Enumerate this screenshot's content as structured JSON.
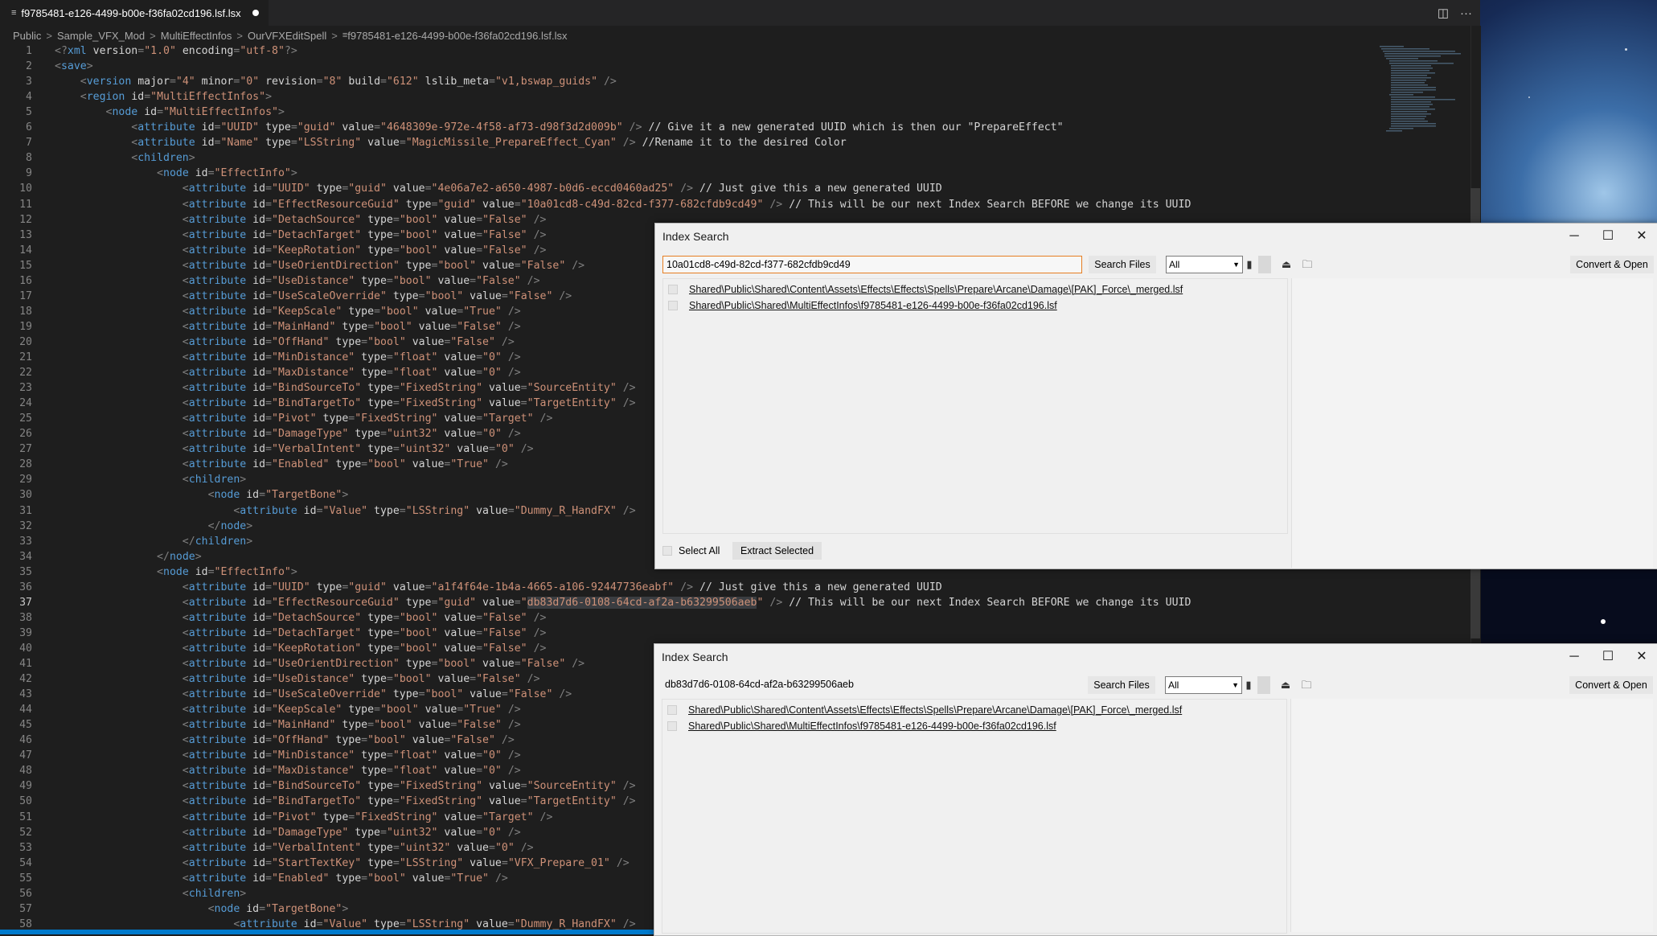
{
  "editor": {
    "tab": {
      "filename": "f9785481-e126-4499-b00e-f36fa02cd196.lsf.lsx",
      "modified_dot": "●"
    },
    "breadcrumb": [
      "Public",
      "Sample_VFX_Mod",
      "MultiEffectInfos",
      "OurVFXEditSpell",
      "f9785481-e126-4499-b00e-f36fa02cd196.lsf.lsx"
    ],
    "breadcrumb_sep": ">",
    "active_line": 37,
    "lines": [
      "<?xml version=\"1.0\" encoding=\"utf-8\"?>",
      "<save>",
      "    <version major=\"4\" minor=\"0\" revision=\"8\" build=\"612\" lslib_meta=\"v1,bswap_guids\" />",
      "    <region id=\"MultiEffectInfos\">",
      "        <node id=\"MultiEffectInfos\">",
      "            <attribute id=\"UUID\" type=\"guid\" value=\"4648309e-972e-4f58-af73-d98f3d2d009b\" /> // Give it a new generated UUID which is then our \"PrepareEffect\"",
      "            <attribute id=\"Name\" type=\"LSString\" value=\"MagicMissile_PrepareEffect_Cyan\" /> //Rename it to the desired Color",
      "            <children>",
      "                <node id=\"EffectInfo\">",
      "                    <attribute id=\"UUID\" type=\"guid\" value=\"4e06a7e2-a650-4987-b0d6-eccd0460ad25\" /> // Just give this a new generated UUID",
      "                    <attribute id=\"EffectResourceGuid\" type=\"guid\" value=\"10a01cd8-c49d-82cd-f377-682cfdb9cd49\" /> // This will be our next Index Search BEFORE we change its UUID",
      "                    <attribute id=\"DetachSource\" type=\"bool\" value=\"False\" />",
      "                    <attribute id=\"DetachTarget\" type=\"bool\" value=\"False\" />",
      "                    <attribute id=\"KeepRotation\" type=\"bool\" value=\"False\" />",
      "                    <attribute id=\"UseOrientDirection\" type=\"bool\" value=\"False\" />",
      "                    <attribute id=\"UseDistance\" type=\"bool\" value=\"False\" />",
      "                    <attribute id=\"UseScaleOverride\" type=\"bool\" value=\"False\" />",
      "                    <attribute id=\"KeepScale\" type=\"bool\" value=\"True\" />",
      "                    <attribute id=\"MainHand\" type=\"bool\" value=\"False\" />",
      "                    <attribute id=\"OffHand\" type=\"bool\" value=\"False\" />",
      "                    <attribute id=\"MinDistance\" type=\"float\" value=\"0\" />",
      "                    <attribute id=\"MaxDistance\" type=\"float\" value=\"0\" />",
      "                    <attribute id=\"BindSourceTo\" type=\"FixedString\" value=\"SourceEntity\" />",
      "                    <attribute id=\"BindTargetTo\" type=\"FixedString\" value=\"TargetEntity\" />",
      "                    <attribute id=\"Pivot\" type=\"FixedString\" value=\"Target\" />",
      "                    <attribute id=\"DamageType\" type=\"uint32\" value=\"0\" />",
      "                    <attribute id=\"VerbalIntent\" type=\"uint32\" value=\"0\" />",
      "                    <attribute id=\"Enabled\" type=\"bool\" value=\"True\" />",
      "                    <children>",
      "                        <node id=\"TargetBone\">",
      "                            <attribute id=\"Value\" type=\"LSString\" value=\"Dummy_R_HandFX\" />",
      "                        </node>",
      "                    </children>",
      "                </node>",
      "                <node id=\"EffectInfo\">",
      "                    <attribute id=\"UUID\" type=\"guid\" value=\"a1f4f64e-1b4a-4665-a106-92447736eabf\" /> // Just give this a new generated UUID",
      "                    <attribute id=\"EffectResourceGuid\" type=\"guid\" value=\"db83d7d6-0108-64cd-af2a-b63299506aeb\" /> // This will be our next Index Search BEFORE we change its UUID",
      "                    <attribute id=\"DetachSource\" type=\"bool\" value=\"False\" />",
      "                    <attribute id=\"DetachTarget\" type=\"bool\" value=\"False\" />",
      "                    <attribute id=\"KeepRotation\" type=\"bool\" value=\"False\" />",
      "                    <attribute id=\"UseOrientDirection\" type=\"bool\" value=\"False\" />",
      "                    <attribute id=\"UseDistance\" type=\"bool\" value=\"False\" />",
      "                    <attribute id=\"UseScaleOverride\" type=\"bool\" value=\"False\" />",
      "                    <attribute id=\"KeepScale\" type=\"bool\" value=\"True\" />",
      "                    <attribute id=\"MainHand\" type=\"bool\" value=\"False\" />",
      "                    <attribute id=\"OffHand\" type=\"bool\" value=\"False\" />",
      "                    <attribute id=\"MinDistance\" type=\"float\" value=\"0\" />",
      "                    <attribute id=\"MaxDistance\" type=\"float\" value=\"0\" />",
      "                    <attribute id=\"BindSourceTo\" type=\"FixedString\" value=\"SourceEntity\" />",
      "                    <attribute id=\"BindTargetTo\" type=\"FixedString\" value=\"TargetEntity\" />",
      "                    <attribute id=\"Pivot\" type=\"FixedString\" value=\"Target\" />",
      "                    <attribute id=\"DamageType\" type=\"uint32\" value=\"0\" />",
      "                    <attribute id=\"VerbalIntent\" type=\"uint32\" value=\"0\" />",
      "                    <attribute id=\"StartTextKey\" type=\"LSString\" value=\"VFX_Prepare_01\" />",
      "                    <attribute id=\"Enabled\" type=\"bool\" value=\"True\" />",
      "                    <children>",
      "                        <node id=\"TargetBone\">",
      "                            <attribute id=\"Value\" type=\"LSString\" value=\"Dummy_R_HandFX\" />"
    ],
    "highlight_text": "db83d7d6-0108-64cd-af2a-b63299506aeb",
    "colors": {
      "tag": "#569cd6",
      "attr": "#9cdcfe",
      "string": "#ce9178",
      "text": "#d4d4d4",
      "punct": "#808080",
      "background": "#1e1e1e",
      "status": "#007acc"
    }
  },
  "search_windows": [
    {
      "title": "Index Search",
      "query": "10a01cd8-c49d-82cd-f377-682cfdb9cd49",
      "search_label": "Search Files",
      "filter": "All",
      "convert_label": "Convert & Open",
      "results": [
        "Shared\\Public\\Shared\\Content\\Assets\\Effects\\Effects\\Spells\\Prepare\\Arcane\\Damage\\[PAK]_Force\\_merged.lsf",
        "Shared\\Public\\Shared\\MultiEffectInfos\\f9785481-e126-4499-b00e-f36fa02cd196.lsf"
      ],
      "select_all_label": "Select All",
      "extract_label": "Extract Selected"
    },
    {
      "title": "Index Search",
      "query": "db83d7d6-0108-64cd-af2a-b63299506aeb",
      "search_label": "Search Files",
      "filter": "All",
      "convert_label": "Convert & Open",
      "results": [
        "Shared\\Public\\Shared\\Content\\Assets\\Effects\\Effects\\Spells\\Prepare\\Arcane\\Damage\\[PAK]_Force\\_merged.lsf",
        "Shared\\Public\\Shared\\MultiEffectInfos\\f9785481-e126-4499-b00e-f36fa02cd196.lsf"
      ]
    }
  ],
  "window_buttons": {
    "minimize": "─",
    "maximize": "☐",
    "close": "✕"
  }
}
